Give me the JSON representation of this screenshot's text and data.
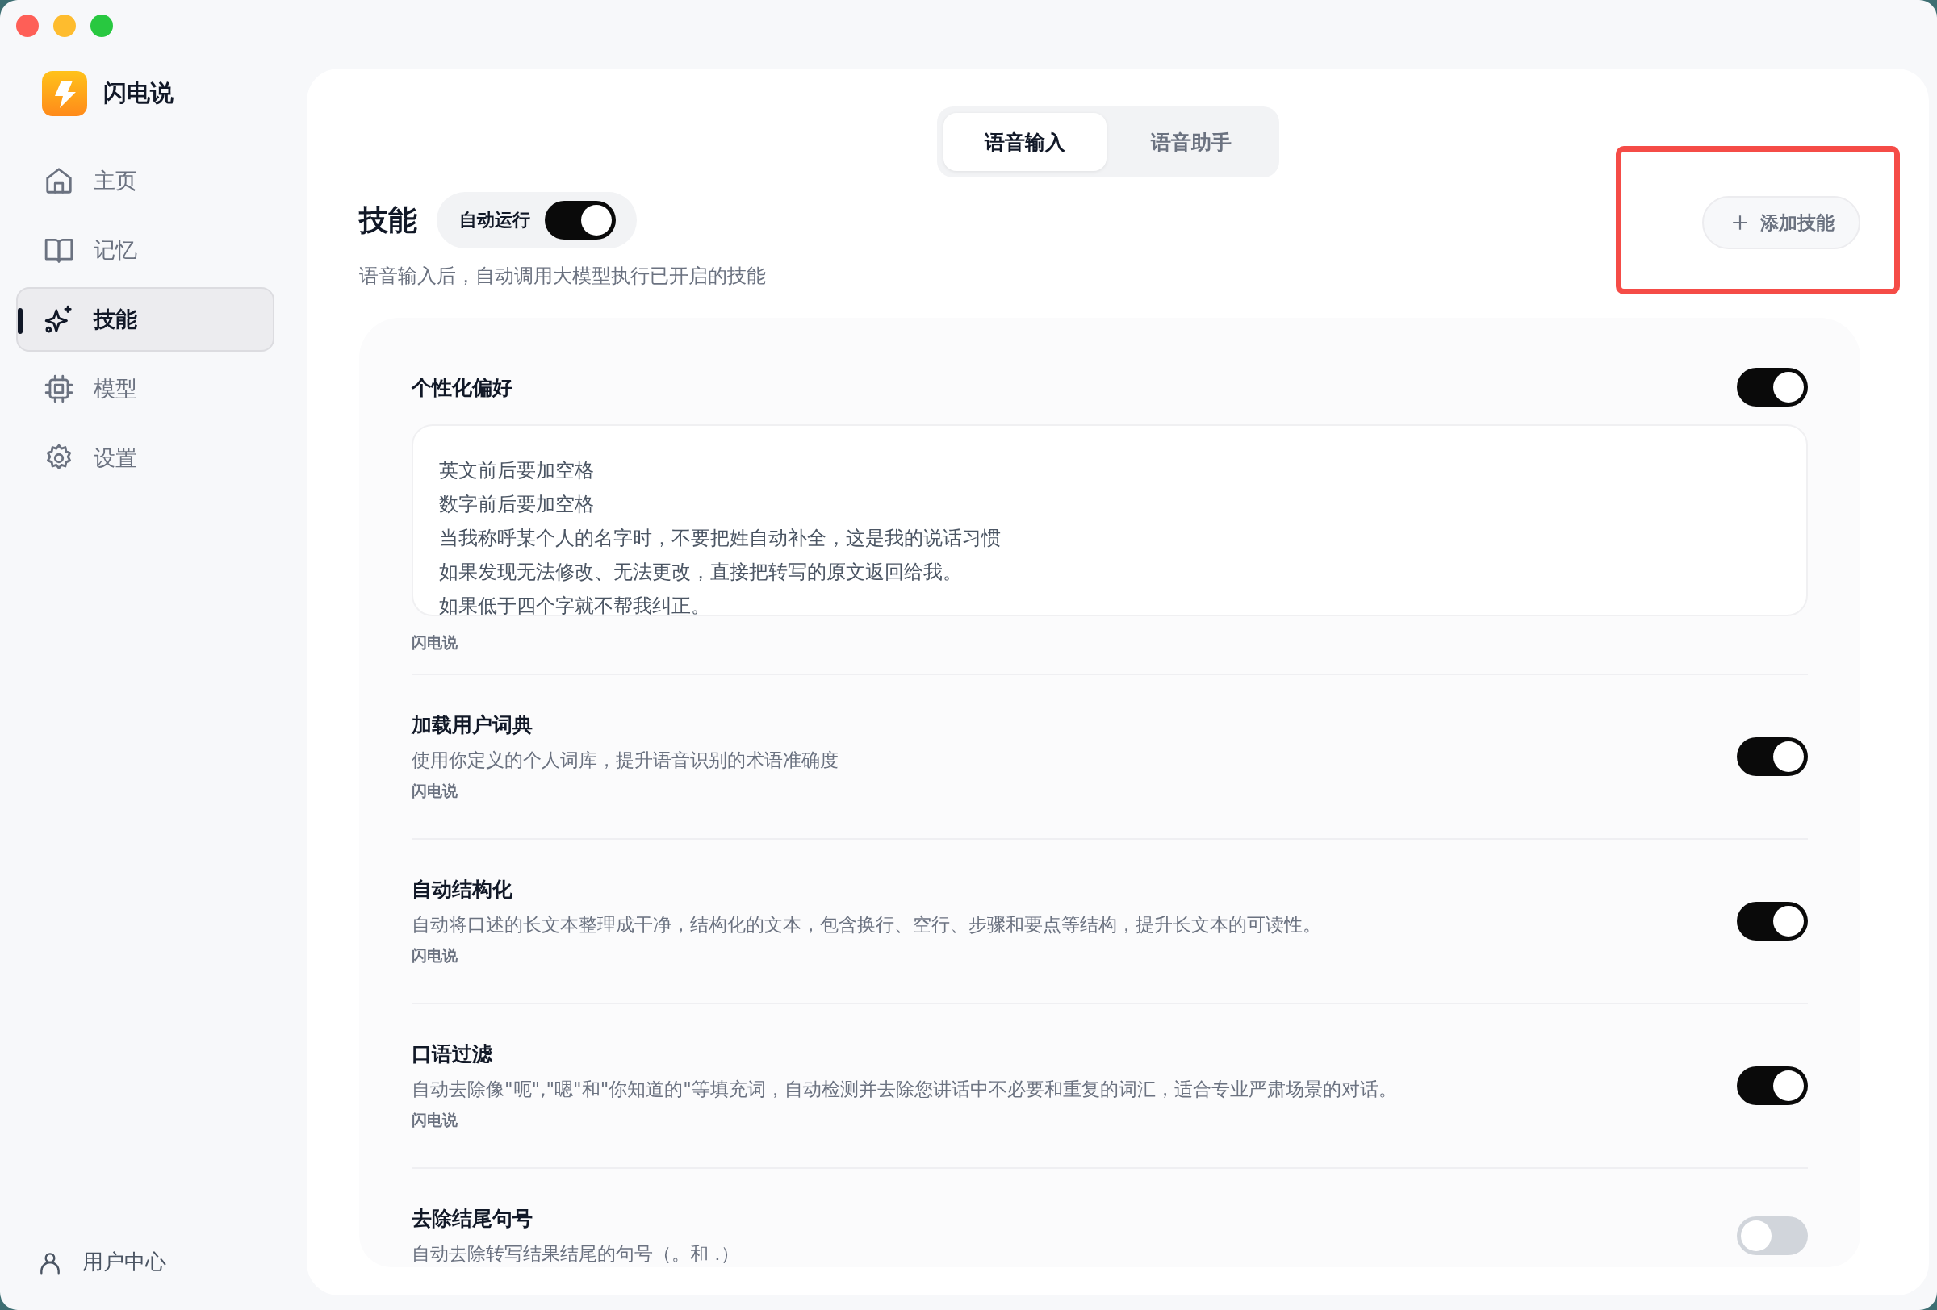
{
  "app": {
    "name": "闪电说"
  },
  "sidebar": {
    "items": [
      {
        "label": "主页",
        "selected": false
      },
      {
        "label": "记忆",
        "selected": false
      },
      {
        "label": "技能",
        "selected": true
      },
      {
        "label": "模型",
        "selected": false
      },
      {
        "label": "设置",
        "selected": false
      }
    ],
    "footer": {
      "label": "用户中心"
    }
  },
  "tabs": [
    {
      "label": "语音输入",
      "selected": true
    },
    {
      "label": "语音助手",
      "selected": false
    }
  ],
  "header": {
    "title": "技能",
    "auto_run": {
      "label": "自动运行",
      "on": true
    },
    "subtitle": "语音输入后，自动调用大模型执行已开启的技能",
    "add_button": "添加技能",
    "highlighted": true
  },
  "skills": [
    {
      "kind": "prompt",
      "title": "个性化偏好",
      "on": true,
      "value": [
        "英文前后要加空格",
        "数字前后要加空格",
        "当我称呼某个人的名字时，不要把姓自动补全，这是我的说话习惯",
        "如果发现无法修改、无法更改，直接把转写的原文返回给我。",
        "如果低于四个字就不帮我纠正。"
      ],
      "source": "闪电说"
    },
    {
      "kind": "description",
      "title": "加载用户词典",
      "on": true,
      "description": "使用你定义的个人词库，提升语音识别的术语准确度",
      "source": "闪电说"
    },
    {
      "kind": "description",
      "title": "自动结构化",
      "on": true,
      "description": "自动将口述的长文本整理成干净，结构化的文本，包含换行、空行、步骤和要点等结构，提升长文本的可读性。",
      "source": "闪电说"
    },
    {
      "kind": "description",
      "title": "口语过滤",
      "on": true,
      "description": "自动去除像\"呃\",\"嗯\"和\"你知道的\"等填充词，自动检测并去除您讲话中不必要和重复的词汇，适合专业严肃场景的对话。",
      "source": "闪电说"
    },
    {
      "kind": "description",
      "title": "去除结尾句号",
      "on": false,
      "description": "自动去除转写结果结尾的句号（。和 .）"
    }
  ]
}
